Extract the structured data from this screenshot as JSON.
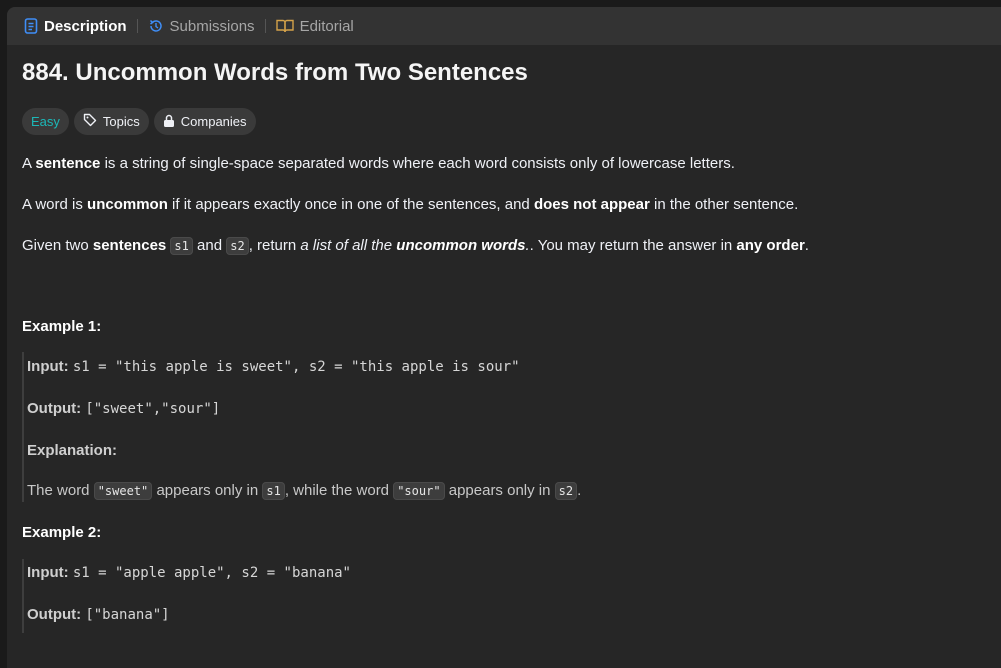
{
  "tabs": [
    {
      "label": "Description",
      "icon": "description-icon",
      "active": true
    },
    {
      "label": "Submissions",
      "icon": "history-icon",
      "active": false
    },
    {
      "label": "Editorial",
      "icon": "book-icon",
      "active": false
    }
  ],
  "problem": {
    "title": "884. Uncommon Words from Two Sentences",
    "difficulty": "Easy",
    "topics_label": "Topics",
    "companies_label": "Companies"
  },
  "description": {
    "p1": {
      "a": "A ",
      "b": "sentence",
      "c": " is a string of single-space separated words where each word consists only of lowercase letters."
    },
    "p2": {
      "a": "A word is ",
      "b": "uncommon",
      "c": " if it appears exactly once in one of the sentences, and ",
      "d": "does not appear",
      "e": " in the other sentence."
    },
    "p3": {
      "a": "Given two ",
      "b": "sentences",
      "c": "s1",
      "d": " and ",
      "e": "s2",
      "f": ", return ",
      "g": "a list of all the ",
      "h": "uncommon words",
      "i": ". You may return the answer in ",
      "j": "any order",
      "k": "."
    }
  },
  "example1": {
    "title": "Example 1:",
    "input_label": "Input:",
    "input_value": "s1 = \"this apple is sweet\", s2 = \"this apple is sour\"",
    "output_label": "Output:",
    "output_value": "[\"sweet\",\"sour\"]",
    "explanation_label": "Explanation:",
    "expl": {
      "a": "The word ",
      "b": "\"sweet\"",
      "c": " appears only in ",
      "d": "s1",
      "e": ", while the word ",
      "f": "\"sour\"",
      "g": " appears only in ",
      "h": "s2",
      "i": "."
    }
  },
  "example2": {
    "title": "Example 2:",
    "input_label": "Input:",
    "input_value": "s1 = \"apple apple\", s2 = \"banana\"",
    "output_label": "Output:",
    "output_value": "[\"banana\"]"
  },
  "colors": {
    "background": "#262626",
    "tabbar": "#333333",
    "easy": "#1cb8b8",
    "active_icon": "#3f8ef7"
  }
}
